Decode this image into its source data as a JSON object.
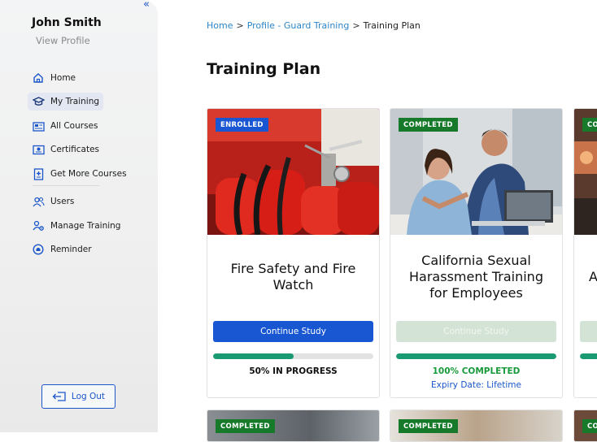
{
  "sidebar": {
    "collapse_icon": "double-chevron-left-icon",
    "user_name": "John Smith",
    "view_profile": "View Profile",
    "items": [
      {
        "label": "Home",
        "icon": "home-icon"
      },
      {
        "label": "My Training",
        "icon": "graduation-cap-icon",
        "active": true
      },
      {
        "label": "All Courses",
        "icon": "courses-icon"
      },
      {
        "label": "Certificates",
        "icon": "certificate-icon"
      },
      {
        "label": "Get More Courses",
        "icon": "add-courses-icon"
      },
      {
        "label": "Users",
        "icon": "users-icon"
      },
      {
        "label": "Manage Training",
        "icon": "manage-training-icon"
      },
      {
        "label": "Reminder",
        "icon": "reminder-icon"
      }
    ],
    "logout_label": "Log Out"
  },
  "breadcrumb": {
    "items": [
      "Home",
      "Profile - Guard Training"
    ],
    "separator": ">",
    "current": "Training Plan"
  },
  "page_title": "Training Plan",
  "cards": [
    {
      "badge": "ENROLLED",
      "title": "Fire Safety and Fire Watch",
      "button": "Continue Study",
      "progress": 50,
      "status": "50% IN PROGRESS",
      "expiry": ""
    },
    {
      "badge": "COMPLETED",
      "title": "California Sexual Harassment Training for Employees",
      "button": "Continue Study",
      "progress": 100,
      "status": "100% COMPLETED",
      "expiry": "Expiry Date: Lifetime"
    },
    {
      "badge": "CO",
      "title": "A",
      "button": "",
      "progress": 100
    }
  ],
  "second_row_badges": [
    "COMPLETED",
    "COMPLETED",
    "CO"
  ],
  "colors": {
    "accent": "#1957d2",
    "link": "#2e86c9",
    "completed_badge": "#177a2a",
    "progress": "#1a9a72"
  }
}
